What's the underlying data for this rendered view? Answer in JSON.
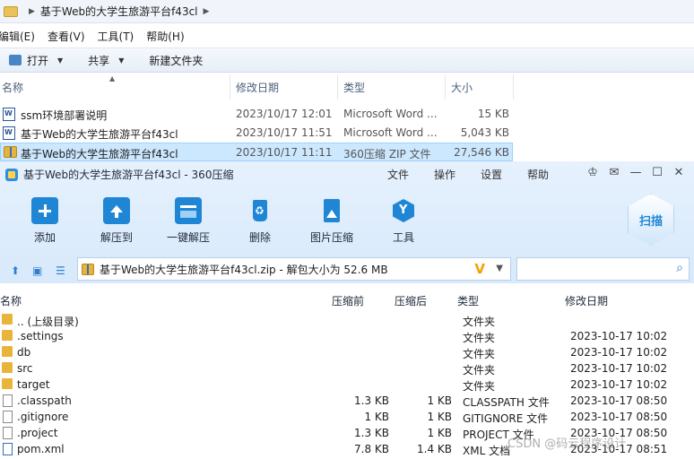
{
  "explorer": {
    "breadcrumb": "基于Web的大学生旅游平台f43cl",
    "menu": [
      "编辑(E)",
      "查看(V)",
      "工具(T)",
      "帮助(H)"
    ],
    "toolbar": {
      "open": "打开",
      "share": "共享",
      "new_folder": "新建文件夹"
    },
    "columns": {
      "name": "名称",
      "modified": "修改日期",
      "type": "类型",
      "size": "大小"
    },
    "rows": [
      {
        "name": "ssm环境部署说明",
        "modified": "2023/10/17 12:01",
        "type": "Microsoft Word ...",
        "size": "15 KB"
      },
      {
        "name": "基于Web的大学生旅游平台f43cl",
        "modified": "2023/10/17 11:51",
        "type": "Microsoft Word ...",
        "size": "5,043 KB"
      },
      {
        "name": "基于Web的大学生旅游平台f43cl",
        "modified": "2023/10/17 11:11",
        "type": "360压缩 ZIP 文件",
        "size": "27,546 KB"
      }
    ]
  },
  "zip": {
    "title": "基于Web的大学生旅游平台f43cl - 360压缩",
    "menu": [
      "文件",
      "操作",
      "设置",
      "帮助"
    ],
    "tools": [
      "添加",
      "解压到",
      "一键解压",
      "删除",
      "图片压缩",
      "工具"
    ],
    "scan": "扫描",
    "path": "基于Web的大学生旅游平台f43cl.zip - 解包大小为 52.6 MB",
    "columns": {
      "name": "名称",
      "packed": "压缩前",
      "compressed": "压缩后",
      "type": "类型",
      "modified": "修改日期"
    },
    "rows": [
      {
        "name": ".. (上级目录)",
        "packed": "",
        "compressed": "",
        "type": "文件夹",
        "modified": ""
      },
      {
        "name": ".settings",
        "packed": "",
        "compressed": "",
        "type": "文件夹",
        "modified": "2023-10-17 10:02"
      },
      {
        "name": "db",
        "packed": "",
        "compressed": "",
        "type": "文件夹",
        "modified": "2023-10-17 10:02"
      },
      {
        "name": "src",
        "packed": "",
        "compressed": "",
        "type": "文件夹",
        "modified": "2023-10-17 10:02"
      },
      {
        "name": "target",
        "packed": "",
        "compressed": "",
        "type": "文件夹",
        "modified": "2023-10-17 10:02"
      },
      {
        "name": ".classpath",
        "packed": "1.3 KB",
        "compressed": "1 KB",
        "type": "CLASSPATH 文件",
        "modified": "2023-10-17 08:50"
      },
      {
        "name": ".gitignore",
        "packed": "1 KB",
        "compressed": "1 KB",
        "type": "GITIGNORE 文件",
        "modified": "2023-10-17 08:50"
      },
      {
        "name": ".project",
        "packed": "1.3 KB",
        "compressed": "1 KB",
        "type": "PROJECT 文件",
        "modified": "2023-10-17 08:50"
      },
      {
        "name": "pom.xml",
        "packed": "7.8 KB",
        "compressed": "1.4 KB",
        "type": "XML 文档",
        "modified": "2023-10-17 08:51"
      }
    ]
  },
  "watermark": "CSDN @码云程序设计"
}
